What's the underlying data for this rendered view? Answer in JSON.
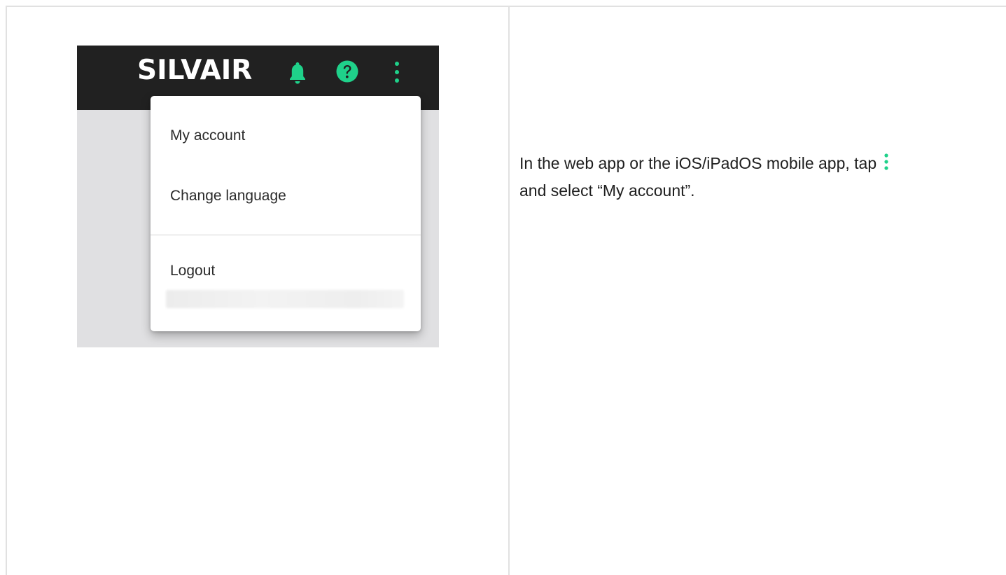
{
  "screenshot": {
    "logo_text": "SILVAIR",
    "icons": {
      "bell": "bell-icon",
      "help": "help-icon",
      "more": "more-vertical-icon"
    },
    "menu": {
      "items": [
        {
          "label": "My account"
        },
        {
          "label": "Change language"
        },
        {
          "label": "Logout"
        }
      ]
    }
  },
  "instruction": {
    "text_before": "In the web app or the iOS/iPadOS mobile app, tap",
    "inline_icon": "more-vertical-icon",
    "text_after": "and select “My account”."
  },
  "colors": {
    "accent": "#1fd18a",
    "topbar": "#212121",
    "panel_background": "#e0e0e2",
    "menu_background": "#ffffff"
  }
}
